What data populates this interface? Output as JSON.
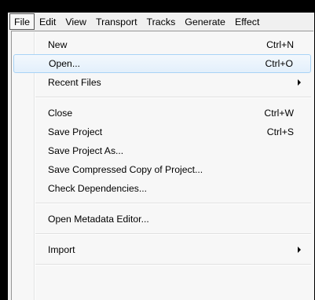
{
  "menubar": {
    "items": [
      {
        "label": "File"
      },
      {
        "label": "Edit"
      },
      {
        "label": "View"
      },
      {
        "label": "Transport"
      },
      {
        "label": "Tracks"
      },
      {
        "label": "Generate"
      },
      {
        "label": "Effect"
      }
    ]
  },
  "file_menu": {
    "items": [
      {
        "label": "New",
        "shortcut": "Ctrl+N"
      },
      {
        "label": "Open...",
        "shortcut": "Ctrl+O"
      },
      {
        "label": "Recent Files"
      },
      {
        "label": "Close",
        "shortcut": "Ctrl+W"
      },
      {
        "label": "Save Project",
        "shortcut": "Ctrl+S"
      },
      {
        "label": "Save Project As..."
      },
      {
        "label": "Save Compressed Copy of Project..."
      },
      {
        "label": "Check Dependencies..."
      },
      {
        "label": "Open Metadata Editor..."
      },
      {
        "label": "Import"
      }
    ]
  },
  "colors": {
    "highlight_border": "#a8d3f6",
    "menu_background": "#f7f7f7"
  }
}
